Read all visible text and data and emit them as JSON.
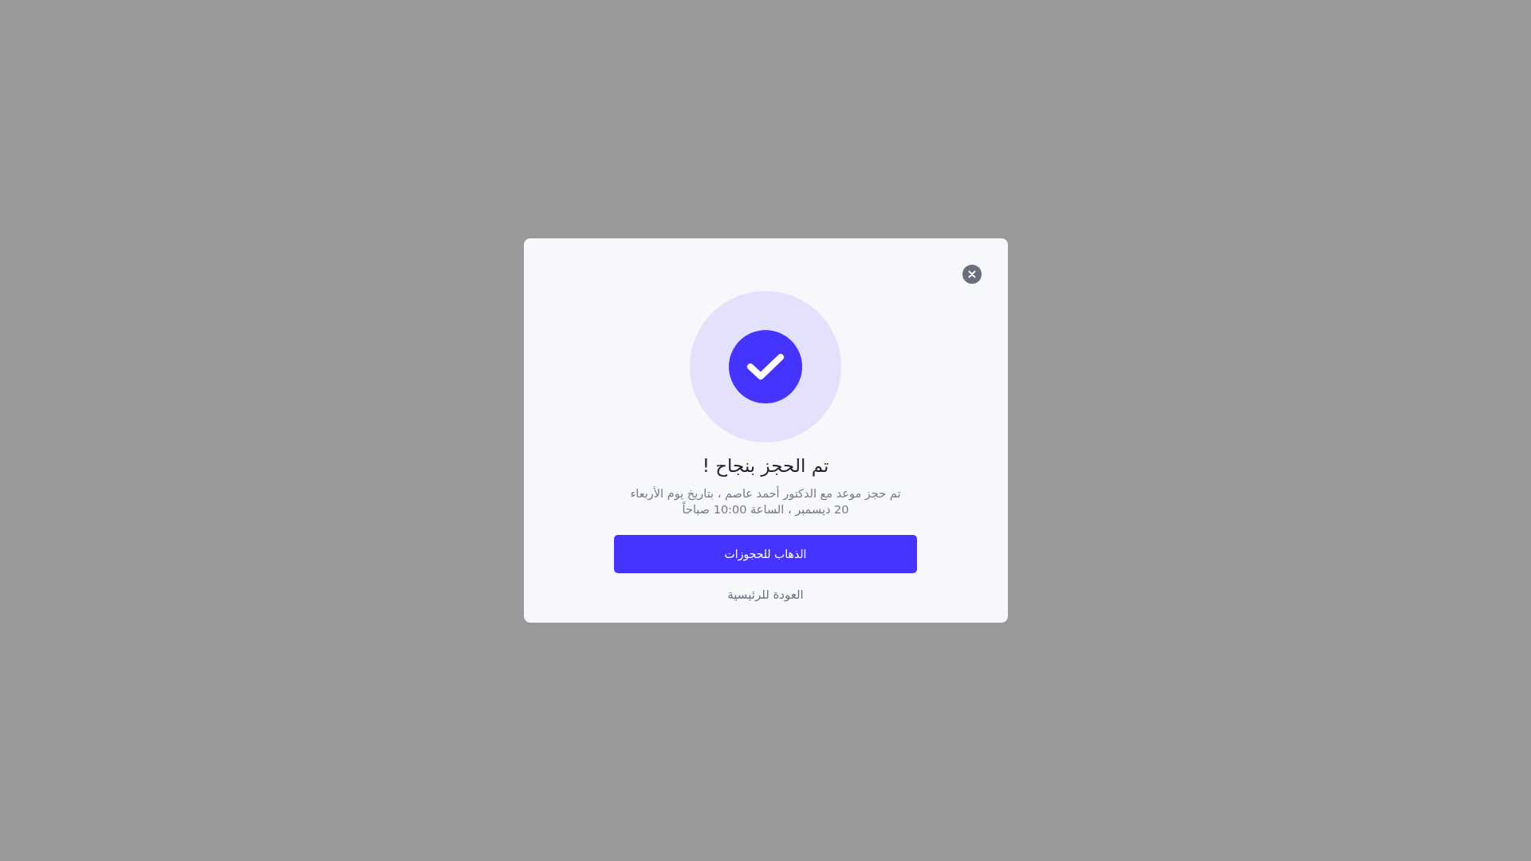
{
  "dialog": {
    "title": "تم الحجز بنجاح !",
    "message": "تم حجز موعد مع الدكتور أحمد عاصم ، بتاريخ يوم الأربعاء 20 ديسمبر ، الساعة 10:00 صباحاً",
    "primary_button": "الذهاب للحجوزات",
    "secondary_link": "العودة للرئيسية"
  }
}
